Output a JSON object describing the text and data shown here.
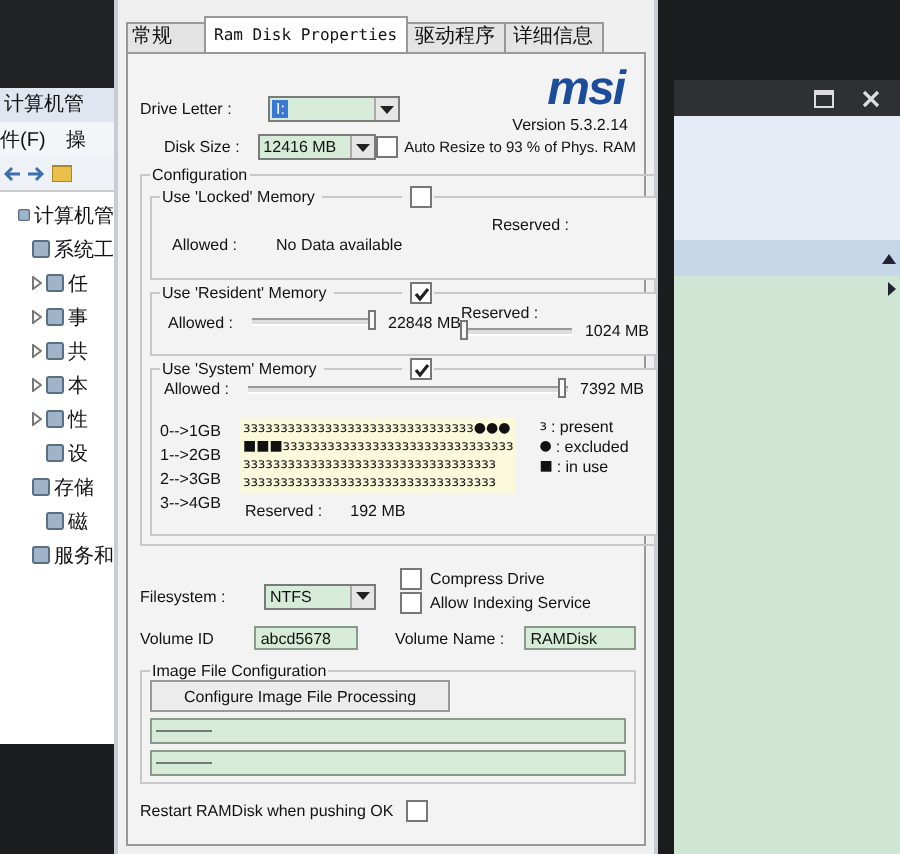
{
  "background_window": {
    "title": "计算机管",
    "menu": [
      "件(F)",
      "操"
    ],
    "tree": [
      {
        "label": "计算机管",
        "children": [
          {
            "label": "系统工",
            "children": [
              {
                "label": "任",
                "expanded": false
              },
              {
                "label": "事",
                "expanded": false
              },
              {
                "label": "共",
                "expanded": false
              },
              {
                "label": "本",
                "expanded": false
              },
              {
                "label": "性",
                "expanded": false
              },
              {
                "label": "设"
              }
            ]
          },
          {
            "label": "存储",
            "children": [
              {
                "label": "磁"
              }
            ]
          },
          {
            "label": "服务和"
          }
        ]
      }
    ]
  },
  "dialog": {
    "tabs": [
      {
        "label": "常规",
        "selected": false
      },
      {
        "label": "Ram Disk Properties",
        "selected": true
      },
      {
        "label": "驱动程序",
        "selected": false
      },
      {
        "label": "详细信息",
        "selected": false
      }
    ],
    "logo": "msi",
    "version": "Version  5.3.2.14",
    "drive_letter": {
      "label": "Drive Letter :",
      "value": "I:"
    },
    "disk_size": {
      "label": "Disk Size :",
      "value": "12416 MB"
    },
    "auto_resize": {
      "checked": false,
      "label": "Auto Resize to  93 % of Phys. RAM"
    },
    "configuration": {
      "title": "Configuration",
      "locked": {
        "label": "Use 'Locked' Memory",
        "checked": false,
        "allowed_label": "Allowed :",
        "allowed_value": "No Data available",
        "reserved_label": "Reserved :"
      },
      "resident": {
        "label": "Use 'Resident' Memory",
        "checked": true,
        "allowed_label": "Allowed :",
        "allowed": {
          "level": 0.97,
          "reading": "22848 MB"
        },
        "reserved_label": "Reserved :",
        "reserved": {
          "level": 0.03,
          "reading": "1024 MB"
        }
      },
      "system": {
        "label": "Use 'System' Memory",
        "checked": true,
        "allowed_label": "Allowed :",
        "allowed": {
          "level": 0.98,
          "reading": "7392 MB"
        }
      },
      "memory_map": {
        "ranges": [
          "0-->1GB",
          "1-->2GB",
          "2-->3GB",
          "3-->4GB"
        ],
        "rows": [
          "ɜɜɜɜɜɜɜɜɜɜɜɜɜɜɜɜɜɜɜɜɜɜɜɜɜɜɜɜɜɜɜ●●●",
          "■■■ɜɜɜɜɜɜɜɜɜɜɜɜɜɜɜɜɜɜɜɜɜɜɜɜɜɜɜɜɜɜɜ",
          "ɜɜɜɜɜɜɜɜɜɜɜɜɜɜɜɜɜɜɜɜɜɜɜɜɜɜɜɜɜɜɜɜɜɜ",
          "ɜɜɜɜɜɜɜɜɜɜɜɜɜɜɜɜɜɜɜɜɜɜɜɜɜɜɜɜɜɜɜɜɜɜ"
        ],
        "legend": [
          {
            "symbol": "ɜ",
            "text": ": present"
          },
          {
            "symbol": "●",
            "text": ": excluded"
          },
          {
            "symbol": "■",
            "text": ": in use"
          }
        ],
        "reserved_label": "Reserved :",
        "reserved_value": "192 MB"
      }
    },
    "filesystem": {
      "label": "Filesystem :",
      "value": "NTFS"
    },
    "options": [
      {
        "label": "Compress Drive",
        "checked": false
      },
      {
        "label": "Allow Indexing Service",
        "checked": false
      }
    ],
    "volume_id": {
      "label": "Volume ID",
      "value": "abcd5678"
    },
    "volume_name": {
      "label": "Volume Name :",
      "value": "RAMDisk"
    },
    "image_file": {
      "title": "Image File Configuration",
      "button": "Configure Image File Processing"
    },
    "restart": {
      "label": "Restart RAMDisk when pushing OK",
      "checked": false
    }
  }
}
